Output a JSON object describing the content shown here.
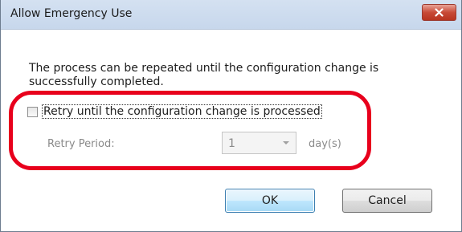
{
  "dialog": {
    "title": "Allow Emergency Use",
    "close_icon": "close-x-icon",
    "description": "The process can be repeated until the configuration change is successfully completed.",
    "retry_checkbox": {
      "label": "Retry until the configuration change is processed",
      "checked": false
    },
    "retry_period": {
      "label": "Retry Period:",
      "value": "1",
      "unit": "day(s)",
      "enabled": false
    },
    "ok_label": "OK",
    "cancel_label": "Cancel"
  },
  "annotation": {
    "color": "#e8001c"
  },
  "colors": {
    "titlebar": "#d4e1f1",
    "close_button": "#c84a36",
    "disabled_text": "#8a8a8a"
  }
}
